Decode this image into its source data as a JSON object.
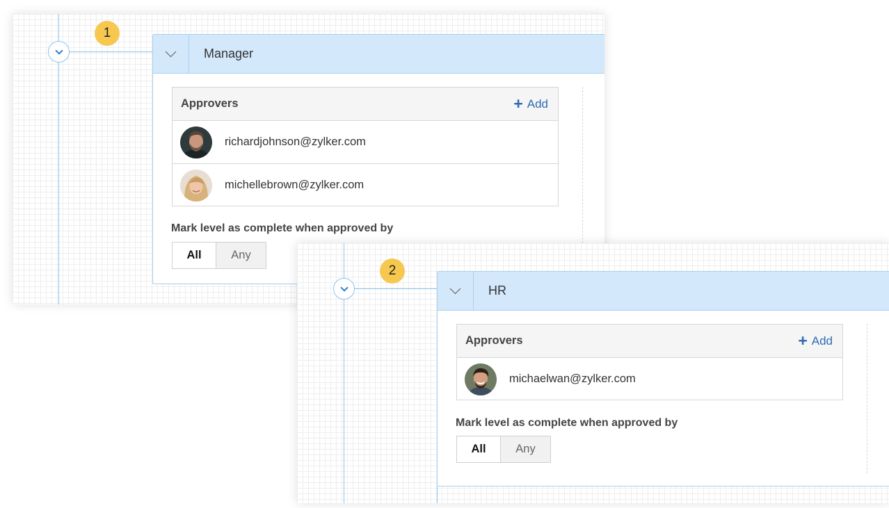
{
  "levels": [
    {
      "number": "1",
      "title": "Manager",
      "approvers_label": "Approvers",
      "add_label": "Add",
      "approvers": [
        {
          "email": "richardjohnson@zylker.com",
          "avatar": "man-with-beard-avatar"
        },
        {
          "email": "michellebrown@zylker.com",
          "avatar": "blonde-woman-avatar"
        }
      ],
      "complete_label": "Mark level as complete when approved by",
      "options": [
        "All",
        "Any"
      ],
      "selected": "All"
    },
    {
      "number": "2",
      "title": "HR",
      "approvers_label": "Approvers",
      "add_label": "Add",
      "approvers": [
        {
          "email": "michaelwan@zylker.com",
          "avatar": "smiling-man-avatar"
        }
      ],
      "complete_label": "Mark level as complete when approved by",
      "options": [
        "All",
        "Any"
      ],
      "selected": "All"
    }
  ],
  "colors": {
    "header_bg": "#d4e8fb",
    "connector": "#8fc4ee",
    "badge": "#f6c850",
    "link": "#2e6bb3"
  }
}
